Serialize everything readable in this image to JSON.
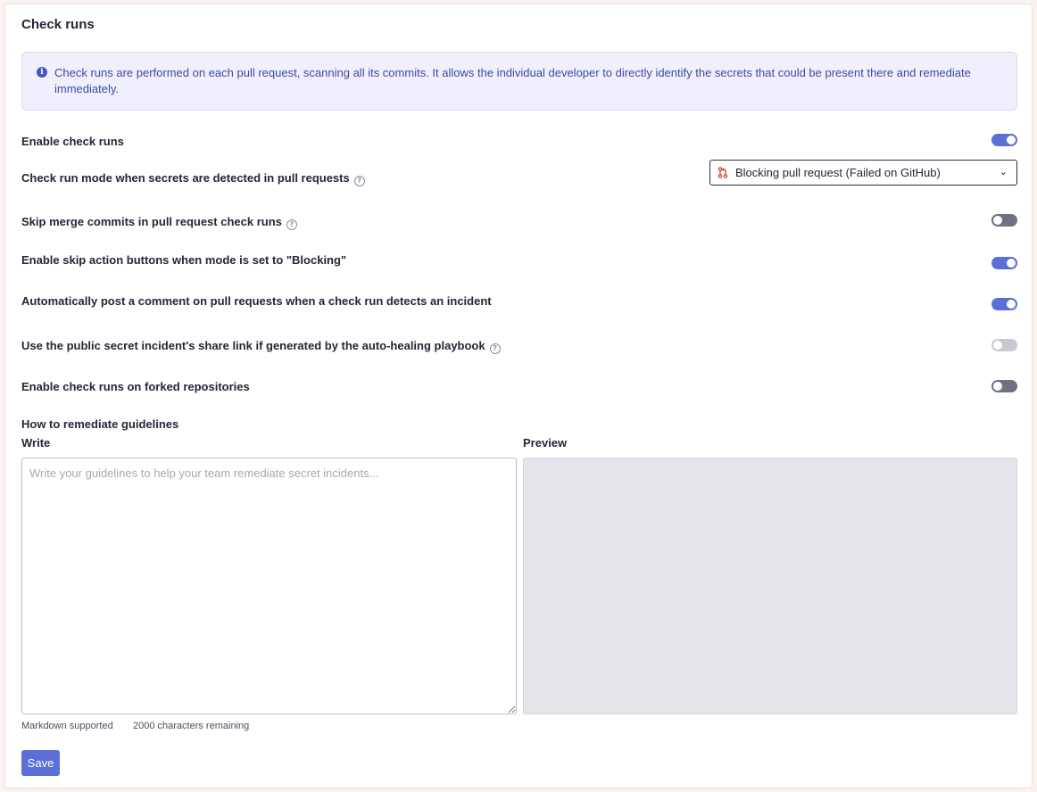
{
  "title": "Check runs",
  "info": {
    "icon": "info-icon",
    "text": "Check runs are performed on each pull request, scanning all its commits. It allows the individual developer to directly identify the secrets that could be present there and remediate immediately."
  },
  "settings": [
    {
      "label": "Enable check runs",
      "help": false,
      "control": "toggle",
      "state": "on"
    },
    {
      "label": "Check run mode when secrets are detected in pull requests",
      "help": true,
      "control": "select",
      "value": "Blocking pull request (Failed on GitHub)"
    },
    {
      "label": "Skip merge commits in pull request check runs",
      "help": true,
      "control": "toggle",
      "state": "off"
    },
    {
      "label": "Enable skip action buttons when mode is set to \"Blocking\"",
      "help": false,
      "control": "toggle",
      "state": "on"
    },
    {
      "label": "Automatically post a comment on pull requests when a check run detects an incident",
      "help": false,
      "control": "toggle",
      "state": "on"
    },
    {
      "label": "Use the public secret incident's share link if generated by the auto-healing playbook",
      "help": true,
      "control": "toggle",
      "state": "disabled"
    },
    {
      "label": "Enable check runs on forked repositories",
      "help": false,
      "control": "toggle",
      "state": "off"
    }
  ],
  "guidelines": {
    "heading": "How to remediate guidelines",
    "write_label": "Write",
    "preview_label": "Preview",
    "placeholder": "Write your guidelines to help your team remediate secret incidents...",
    "markdown_hint": "Markdown supported",
    "remaining": "2000 characters remaining"
  },
  "save_label": "Save",
  "colors": {
    "accent": "#5b6fd6",
    "info_bg": "#eff0fb",
    "info_text": "#3b4aa8",
    "pr_icon": "#d93f2b"
  }
}
